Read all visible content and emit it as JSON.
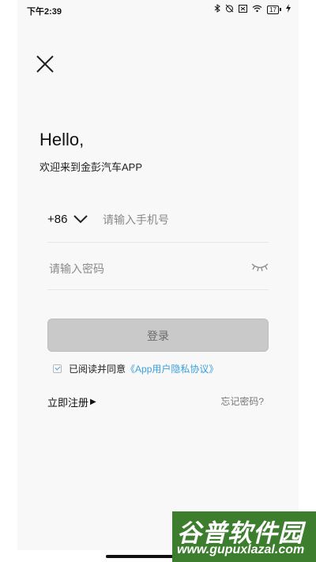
{
  "status_bar": {
    "time": "下午2:39",
    "icons": [
      "bluetooth-icon",
      "alarm-off-icon",
      "sim-icon",
      "wifi-icon",
      "battery-icon",
      "charging-icon"
    ],
    "battery_level": "17"
  },
  "header": {
    "close_icon": "close-icon"
  },
  "greeting": {
    "title": "Hello,",
    "subtitle": "欢迎来到金彭汽车APP"
  },
  "phone": {
    "country_code": "+86",
    "placeholder": "请输入手机号",
    "value": ""
  },
  "password": {
    "placeholder": "请输入密码",
    "value": "",
    "toggle_icon": "eye-closed-icon"
  },
  "login_button": {
    "label": "登录"
  },
  "agreement": {
    "checked": true,
    "text": "已阅读并同意",
    "link": "《App用户隐私协议》"
  },
  "register": {
    "label": "立即注册",
    "arrow": "▶"
  },
  "forgot": {
    "label": "忘记密码?"
  },
  "watermark": {
    "title": "谷普软件园",
    "url": "www.gupuxlazal.com"
  }
}
